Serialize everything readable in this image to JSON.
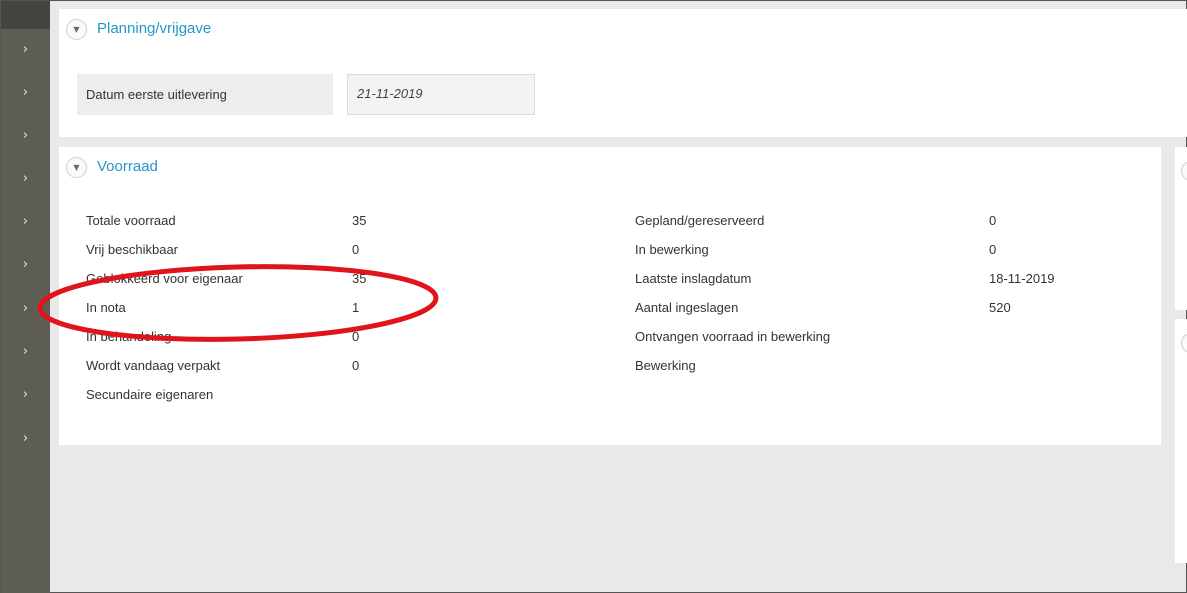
{
  "sidebar": {
    "chevron_glyph": "›",
    "item_count": 10
  },
  "planning": {
    "title": "Planning/vrijgave",
    "toggle_glyph": "▼",
    "field_label": "Datum eerste uitlevering",
    "field_value": "21-11-2019"
  },
  "voorraad": {
    "title": "Voorraad",
    "toggle_glyph": "▼",
    "left_rows": [
      {
        "label": "Totale voorraad",
        "value": "35"
      },
      {
        "label": "Vrij beschikbaar",
        "value": "0"
      },
      {
        "label": "Geblokkeerd voor eigenaar",
        "value": "35"
      },
      {
        "label": "In nota",
        "value": "1"
      },
      {
        "label": "In behandeling",
        "value": "0"
      },
      {
        "label": "Wordt vandaag verpakt",
        "value": "0"
      },
      {
        "label": "Secundaire eigenaren",
        "value": ""
      }
    ],
    "right_rows": [
      {
        "label": "Gepland/gereserveerd",
        "value": "0"
      },
      {
        "label": "In bewerking",
        "value": "0"
      },
      {
        "label": "Laatste inslagdatum",
        "value": "18-11-2019"
      },
      {
        "label": "Aantal ingeslagen",
        "value": "520"
      },
      {
        "label": "Ontvangen voorraad in bewerking",
        "value": ""
      },
      {
        "label": "Bewerking",
        "value": ""
      }
    ]
  },
  "colors": {
    "accent": "#2596c8",
    "sidebar": "#5d5d55",
    "annotation": "#e0141b"
  }
}
